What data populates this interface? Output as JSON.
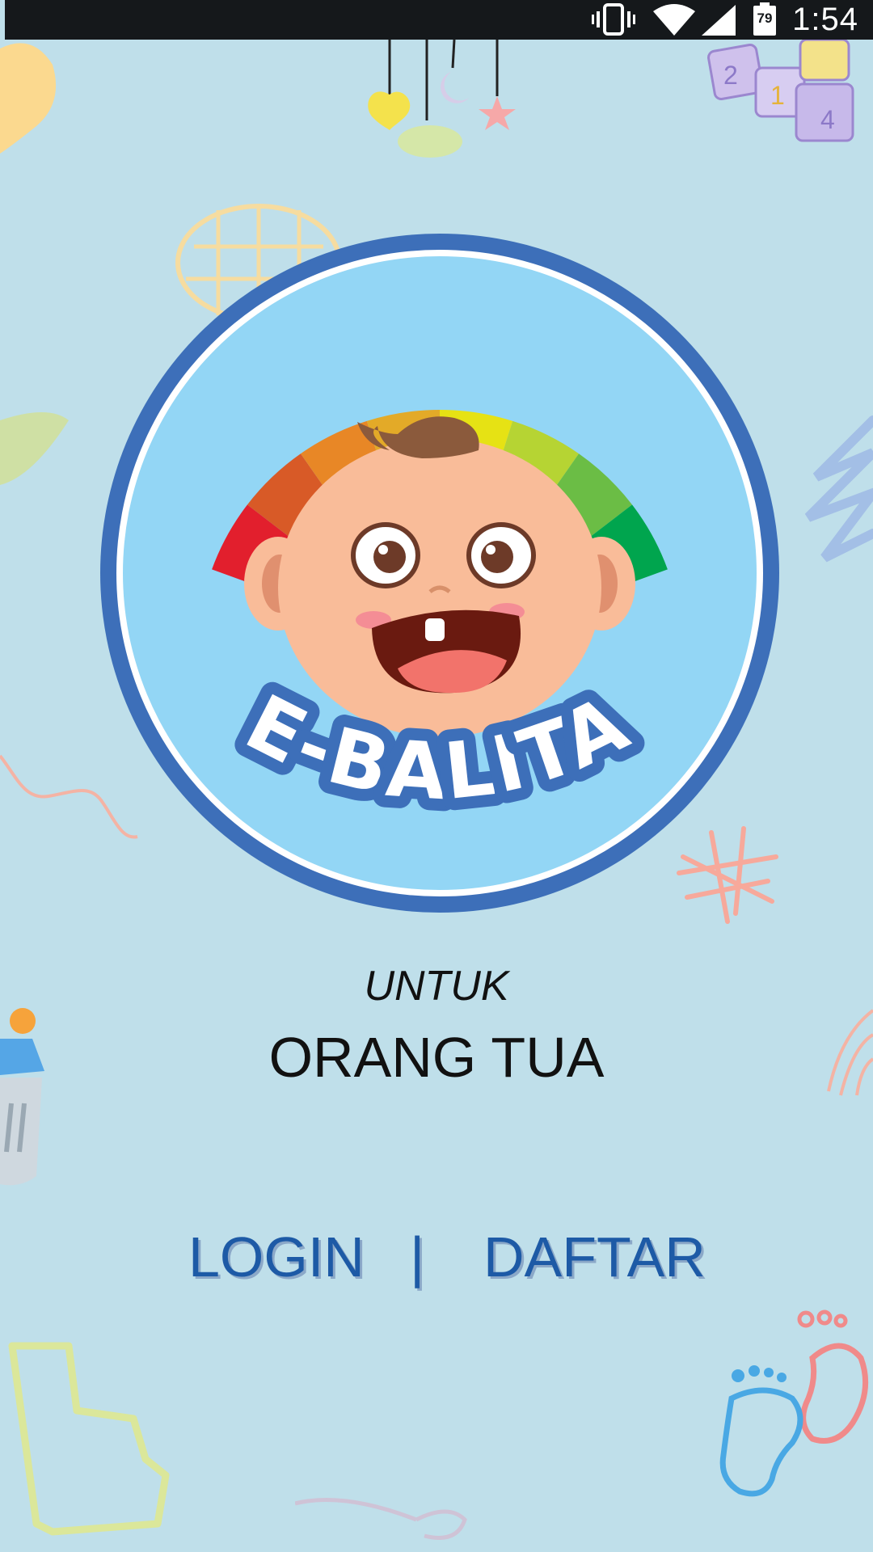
{
  "status_bar": {
    "time": "1:54",
    "battery_level": "79",
    "icons": [
      "vibrate-icon",
      "wifi-icon",
      "cell-signal-icon",
      "battery-icon"
    ]
  },
  "logo": {
    "text": "E-BALITA",
    "ring_color": "#3d6fb9",
    "inner_color": "#93d6f5",
    "gauge_colors": [
      "#e21f2d",
      "#d85a27",
      "#e88726",
      "#e3aa28",
      "#e6e214",
      "#b6d433",
      "#6bbd45",
      "#00a54e"
    ]
  },
  "subtitle": "UNTUK",
  "title": "ORANG TUA",
  "auth": {
    "login_label": "LOGIN",
    "separator": "|",
    "register_label": "DAFTAR"
  },
  "colors": {
    "background": "#bfdfea",
    "link": "#1d5aa6"
  }
}
